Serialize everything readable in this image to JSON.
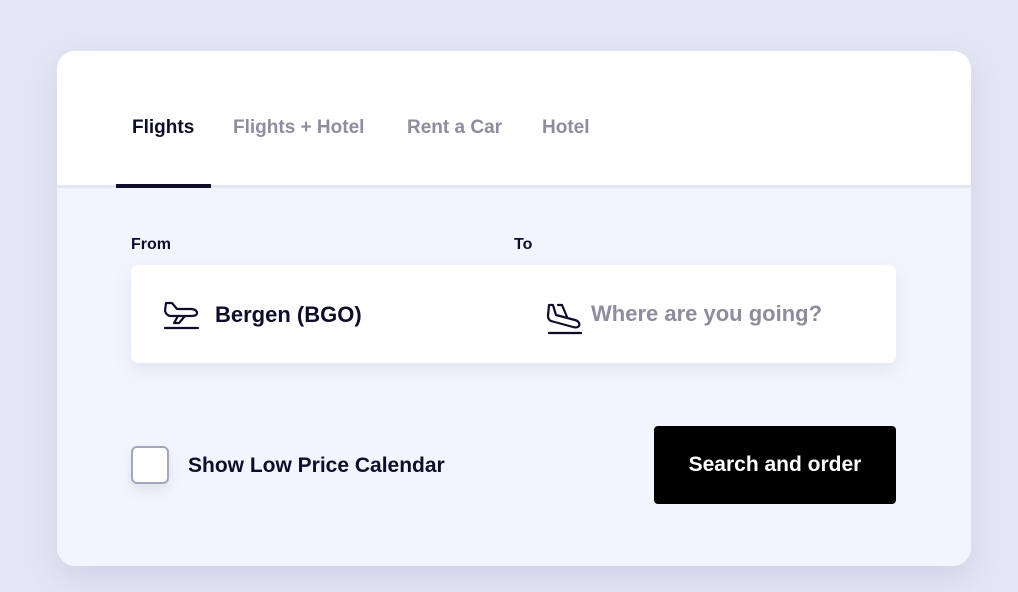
{
  "tabs": [
    {
      "label": "Flights",
      "active": true
    },
    {
      "label": "Flights + Hotel",
      "active": false
    },
    {
      "label": "Rent a Car",
      "active": false
    },
    {
      "label": "Hotel",
      "active": false
    }
  ],
  "form": {
    "from_label": "From",
    "to_label": "To",
    "from_value": "Bergen (BGO)",
    "from_icon": "plane-takeoff-icon",
    "to_placeholder": "Where are you going?",
    "to_value": "",
    "to_icon": "plane-landing-icon"
  },
  "options": {
    "low_price_calendar_label": "Show Low Price Calendar",
    "low_price_calendar_checked": false
  },
  "actions": {
    "search_label": "Search and order"
  },
  "colors": {
    "background": "#e3e6f4",
    "card": "#f2f5fd",
    "text_primary": "#0e0e2a",
    "text_muted": "#8d8d9e",
    "button": "#000000"
  }
}
